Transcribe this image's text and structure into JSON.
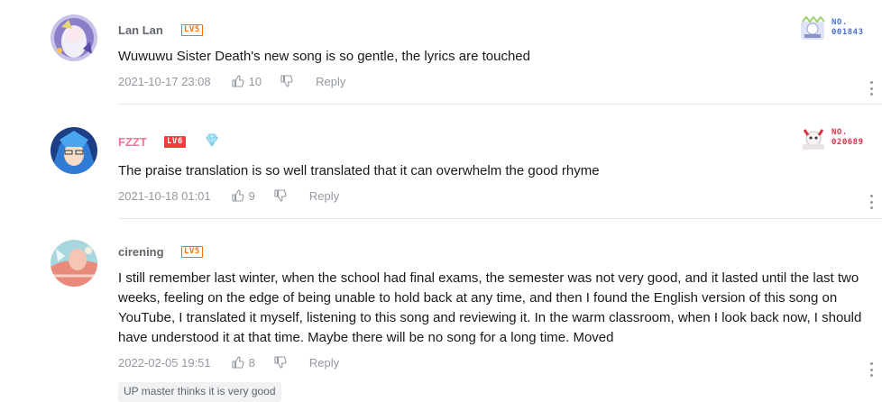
{
  "comments": [
    {
      "username": "Lan Lan",
      "level": "LV5",
      "text": "Wuwuwu Sister Death's new song is so gentle, the lyrics are touched",
      "date": "2021-10-17 23:08",
      "likes": "10",
      "reply_label": "Reply",
      "badge_no": "NO.",
      "badge_num": "001843",
      "badge_color": "#4a6fd4"
    },
    {
      "username": "FZZT",
      "level": "LV6",
      "text": "The praise translation is so well translated that it can overwhelm the good rhyme",
      "date": "2021-10-18 01:01",
      "likes": "9",
      "reply_label": "Reply",
      "badge_no": "NO.",
      "badge_num": "020689",
      "badge_color": "#e0304a"
    },
    {
      "username": "cirening",
      "level": "LV5",
      "text": "I still remember last winter, when the school had final exams, the semester was not very good, and it lasted until the last two weeks, feeling on the edge of being unable to hold back at any time, and then I found the English version of this song on YouTube, I translated it myself, listening to this song and reviewing it. In the warm classroom, when I look back now, I should have understood it at that time. Maybe there will be no song for a long time. Moved",
      "date": "2022-02-05 19:51",
      "likes": "8",
      "reply_label": "Reply",
      "up_tag": "UP master thinks it is very good"
    }
  ],
  "colors": {
    "vip_name": "#fb7299",
    "level_orange": "#ff6d00",
    "level_red": "#f43c3c",
    "meta_gray": "#9499a0"
  },
  "icons": {
    "like": "thumbs-up-icon",
    "dislike": "thumbs-down-icon",
    "more": "more-vertical-icon",
    "fan_badge": "diamond-icon"
  }
}
